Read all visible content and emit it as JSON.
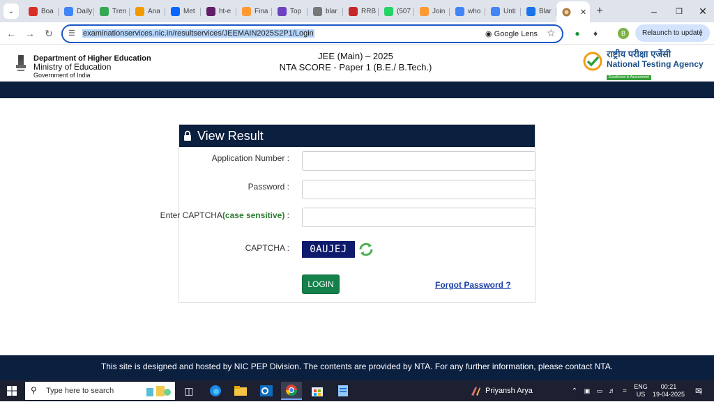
{
  "browser": {
    "tabs": [
      {
        "label": "Boa",
        "icon": "gmail-icon",
        "color": "#d93025"
      },
      {
        "label": "Daily",
        "icon": "docs-icon",
        "color": "#4285f4"
      },
      {
        "label": "Tren",
        "icon": "trends-icon",
        "color": "#34a853"
      },
      {
        "label": "Ana",
        "icon": "analytics-icon",
        "color": "#f29900"
      },
      {
        "label": "Met",
        "icon": "meta-icon",
        "color": "#0866ff"
      },
      {
        "label": "ht-e",
        "icon": "slack-icon",
        "color": "#611f69"
      },
      {
        "label": "Fina",
        "icon": "india-flag-icon",
        "color": "#ff9933"
      },
      {
        "label": "Top",
        "icon": "x-icon",
        "color": "#6f42c1"
      },
      {
        "label": "blar",
        "icon": "globe-icon",
        "color": "#777777"
      },
      {
        "label": "RRB",
        "icon": "rrb-icon",
        "color": "#c62828"
      },
      {
        "label": "(507",
        "icon": "whatsapp-icon",
        "color": "#25d366"
      },
      {
        "label": "Join",
        "icon": "india-flag-icon",
        "color": "#ff9933"
      },
      {
        "label": "who",
        "icon": "google-icon",
        "color": "#4285f4"
      },
      {
        "label": "Unti",
        "icon": "docs-icon",
        "color": "#4285f4"
      },
      {
        "label": "Blar",
        "icon": "blogger-icon",
        "color": "#1a73e8"
      }
    ],
    "active_tab_icon": "nta-tab-icon",
    "url": "examinationservices.nic.in/resultservices/JEEMAIN2025S2P1/Login",
    "lens_label": "Google Lens",
    "profile_initial": "B",
    "relaunch_label": "Relaunch to update"
  },
  "header": {
    "dept_line1": "Department of Higher Education",
    "dept_line2": "Ministry of Education",
    "dept_line3": "Government of India",
    "exam_line1": "JEE (Main) – 2025",
    "exam_line2": "NTA SCORE - Paper 1 (B.E./ B.Tech.)",
    "nta_hindi": "राष्ट्रीय परीक्षा एजेंसी",
    "nta_english": "National Testing Agency",
    "nta_tagline": "Excellence in Assessment"
  },
  "form": {
    "title": "View Result",
    "application_label": "Application Number :",
    "application_value": "",
    "password_label": "Password :",
    "password_value": "",
    "captcha_entry_label": "Enter CAPTCHA",
    "captcha_entry_note": "(case sensitive)",
    "captcha_entry_suffix": " :",
    "captcha_entry_value": "",
    "captcha_label": "CAPTCHA :",
    "captcha_text": "0AUJEJ",
    "login_label": "LOGIN",
    "forgot_label": "Forgot Password ?"
  },
  "footer": {
    "text": "This site is designed and hosted by NIC PEP Division. The contents are provided by NTA. For any further information, please contact NTA."
  },
  "taskbar": {
    "search_placeholder": "Type here to search",
    "task_label": "Priyansh Arya Mocke...",
    "lang_line1": "ENG",
    "lang_line2": "US",
    "time": "00:21",
    "date": "19-04-2025",
    "notification_count": "1"
  }
}
